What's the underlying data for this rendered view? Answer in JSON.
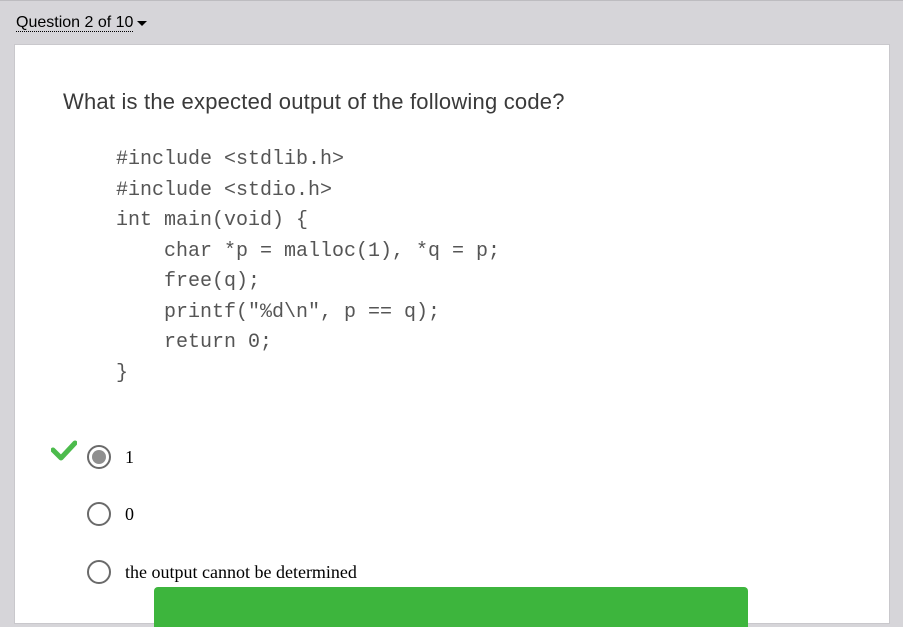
{
  "header": {
    "question_counter": "Question 2 of 10"
  },
  "question": {
    "prompt": "What is the expected output of the following code?",
    "code_lines": [
      "#include <stdlib.h>",
      "#include <stdio.h>",
      "int main(void) {",
      "    char *p = malloc(1), *q = p;",
      "    free(q);",
      "    printf(\"%d\\n\", p == q);",
      "    return 0;",
      "}"
    ]
  },
  "options": [
    {
      "label": "1",
      "selected": true,
      "marked_correct": true
    },
    {
      "label": "0",
      "selected": false,
      "marked_correct": false
    },
    {
      "label": "the output cannot be determined",
      "selected": false,
      "marked_correct": false
    }
  ],
  "colors": {
    "accent_green": "#3db53d",
    "check_green": "#4cbb4c",
    "background": "#d6d5d9"
  },
  "icons": {
    "caret": "chevron-down-icon",
    "correct": "check-icon"
  }
}
